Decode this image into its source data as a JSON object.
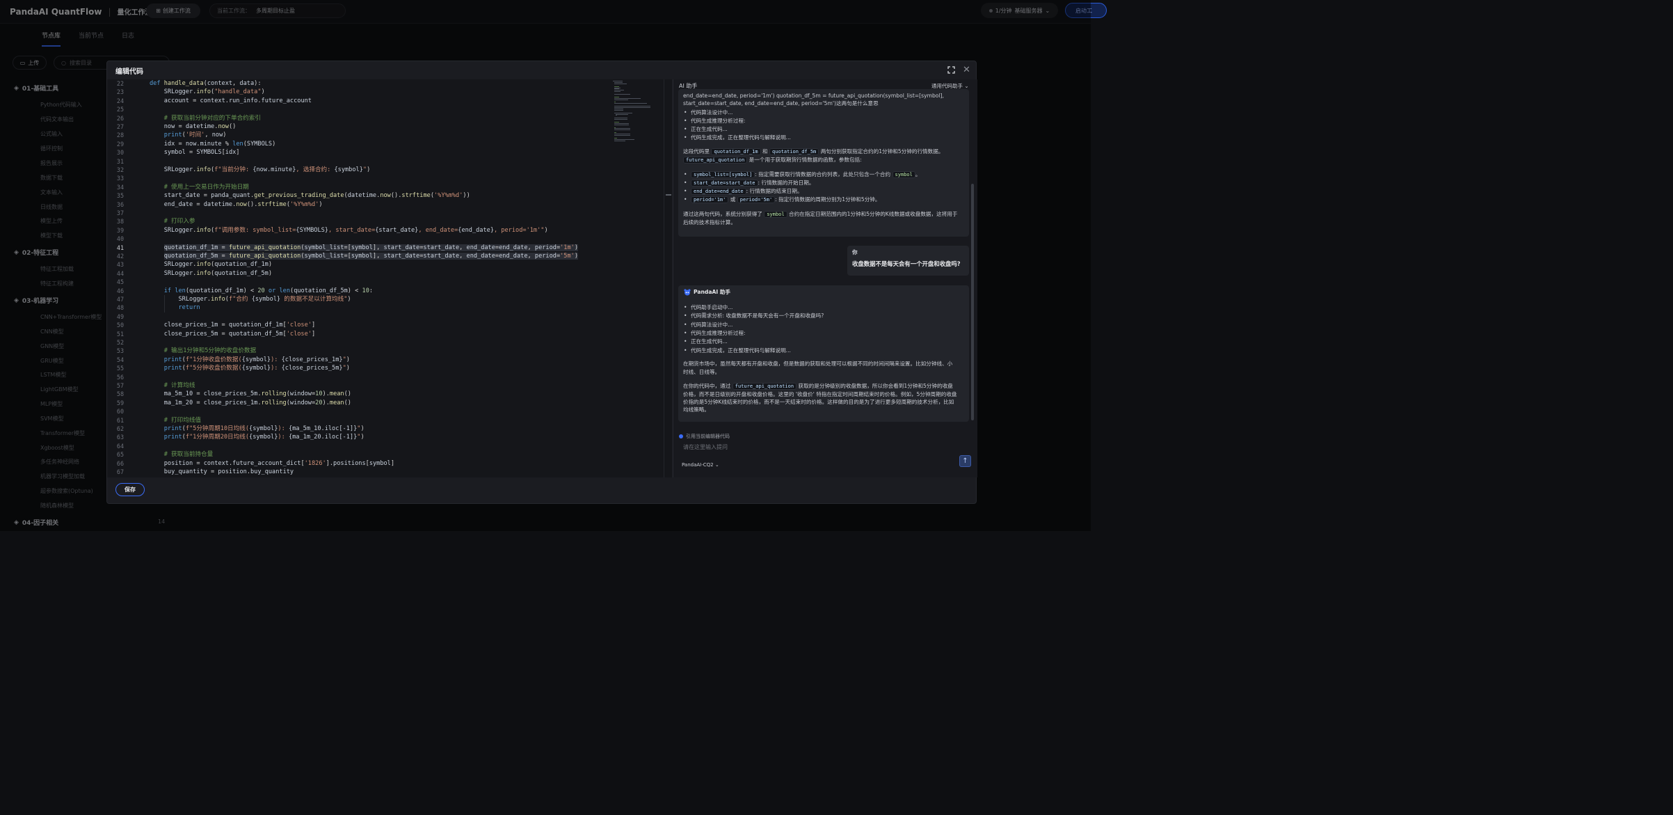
{
  "app": {
    "brand": "PandaAI QuantFlow",
    "subtitle": "量化工作流"
  },
  "topbar": {
    "create_label": "创建工作流",
    "workflow_prefix": "当前工作流：",
    "workflow_name": "多周期目标止盈",
    "rate_label": "1/分钟",
    "server_label": "基础服务器",
    "start_label": "启动工"
  },
  "left": {
    "tabs": [
      "节点库",
      "当前节点",
      "日志"
    ],
    "upload_label": "上传",
    "search_placeholder": "搜索目录",
    "categories": [
      {
        "name": "01-基础工具",
        "nodes": [
          "Python代码输入",
          "代码文本输出",
          "公式输入",
          "循环控制",
          "报告展示",
          "数据下载",
          "文本输入",
          "日线数据",
          "模型上传",
          "模型下载"
        ]
      },
      {
        "name": "02-特征工程",
        "nodes": [
          "特征工程加载",
          "特征工程构建"
        ]
      },
      {
        "name": "03-机器学习",
        "nodes": [
          "CNN+Transformer模型",
          "CNN模型",
          "GNN模型",
          "GRU模型",
          "LSTM模型",
          "LightGBM模型",
          "MLP模型",
          "SVM模型",
          "Transformer模型",
          "Xgboost模型",
          "多任务神经网络",
          "机器学习模型加载",
          "超参数搜索(Optuna)",
          "随机森林模型"
        ]
      },
      {
        "name": "04-因子相关",
        "nodes": []
      }
    ],
    "last_count": "14"
  },
  "modal": {
    "title": "编辑代码",
    "save_label": "保存",
    "code_lines": [
      {
        "n": "22",
        "t": "def handle_data(context, data):"
      },
      {
        "n": "23",
        "t": "    SRLogger.info(\"handle_data\")"
      },
      {
        "n": "24",
        "t": "    account = context.run_info.future_account"
      },
      {
        "n": "25",
        "t": ""
      },
      {
        "n": "26",
        "t": "    # 获取当前分钟对应的下单合约索引"
      },
      {
        "n": "27",
        "t": "    now = datetime.now()"
      },
      {
        "n": "28",
        "t": "    print('时间', now)"
      },
      {
        "n": "29",
        "t": "    idx = now.minute % len(SYMBOLS)"
      },
      {
        "n": "30",
        "t": "    symbol = SYMBOLS[idx]"
      },
      {
        "n": "31",
        "t": ""
      },
      {
        "n": "32",
        "t": "    SRLogger.info(f\"当前分钟: {now.minute}, 选择合约: {symbol}\")"
      },
      {
        "n": "33",
        "t": ""
      },
      {
        "n": "34",
        "t": "    # 使用上一交易日作为开始日期"
      },
      {
        "n": "35",
        "t": "    start_date = panda_quant.get_previous_trading_date(datetime.now().strftime('%Y%m%d'))"
      },
      {
        "n": "36",
        "t": "    end_date = datetime.now().strftime('%Y%m%d')"
      },
      {
        "n": "37",
        "t": ""
      },
      {
        "n": "38",
        "t": "    # 打印入参"
      },
      {
        "n": "39",
        "t": "    SRLogger.info(f\"调用参数: symbol_list={SYMBOLS}, start_date={start_date}, end_date={end_date}, period='1m'\")"
      },
      {
        "n": "40",
        "t": ""
      },
      {
        "n": "41",
        "t": "    quotation_df_1m = future_api_quotation(symbol_list=[symbol], start_date=start_date, end_date=end_date, period='1m')"
      },
      {
        "n": "42",
        "t": "    quotation_df_5m = future_api_quotation(symbol_list=[symbol], start_date=start_date, end_date=end_date, period='5m')"
      },
      {
        "n": "43",
        "t": "    SRLogger.info(quotation_df_1m)"
      },
      {
        "n": "44",
        "t": "    SRLogger.info(quotation_df_5m)"
      },
      {
        "n": "45",
        "t": ""
      },
      {
        "n": "46",
        "t": "    if len(quotation_df_1m) < 20 or len(quotation_df_5m) < 10:"
      },
      {
        "n": "47",
        "t": "        SRLogger.info(f\"合约 {symbol} 的数据不足以计算均线\")"
      },
      {
        "n": "48",
        "t": "        return"
      },
      {
        "n": "49",
        "t": ""
      },
      {
        "n": "50",
        "t": "    close_prices_1m = quotation_df_1m['close']"
      },
      {
        "n": "51",
        "t": "    close_prices_5m = quotation_df_5m['close']"
      },
      {
        "n": "52",
        "t": ""
      },
      {
        "n": "53",
        "t": "    # 输出1分钟和5分钟的收盘价数据"
      },
      {
        "n": "54",
        "t": "    print(f\"1分钟收盘价数据({symbol}): {close_prices_1m}\")"
      },
      {
        "n": "55",
        "t": "    print(f\"5分钟收盘价数据({symbol}): {close_prices_5m}\")"
      },
      {
        "n": "56",
        "t": ""
      },
      {
        "n": "57",
        "t": "    # 计算均线"
      },
      {
        "n": "58",
        "t": "    ma_5m_10 = close_prices_5m.rolling(window=10).mean()"
      },
      {
        "n": "59",
        "t": "    ma_1m_20 = close_prices_1m.rolling(window=20).mean()"
      },
      {
        "n": "60",
        "t": ""
      },
      {
        "n": "61",
        "t": "    # 打印均线值"
      },
      {
        "n": "62",
        "t": "    print(f\"5分钟周期10日均线({symbol}): {ma_5m_10.iloc[-1]}\")"
      },
      {
        "n": "63",
        "t": "    print(f\"1分钟周期20日均线({symbol}): {ma_1m_20.iloc[-1]}\")"
      },
      {
        "n": "64",
        "t": ""
      },
      {
        "n": "65",
        "t": "    # 获取当前持仓量"
      },
      {
        "n": "66",
        "t": "    position = context.future_account_dict['1826'].positions[symbol]"
      },
      {
        "n": "67",
        "t": "    buy_quantity = position.buy_quantity"
      }
    ]
  },
  "ai": {
    "title": "AI 助手",
    "selector": "通用代码助手",
    "msg1": {
      "head1": "end_date=end_date, period='1m') quotation_df_5m = future_api_quotation(symbol_list=[symbol],",
      "head2": "start_date=start_date, end_date=end_date, period='5m')这两句是什么意思",
      "steps": [
        "代码算法设计中...",
        "代码生成推理分析过程:",
        "正在生成代码...",
        "代码生成完成，正在整理代码与解释说明..."
      ],
      "p1a": "这段代码里",
      "p1_code1": "quotation_df_1m",
      "p1b": "和",
      "p1_code2": "quotation_df_5m",
      "p1c": "两句分别获取指定合约的1分钟和5分钟的行情数据。",
      "p1_code3": "future_api_quotation",
      "p1d": "是一个用于获取期货行情数据的函数，参数包括:",
      "params": [
        {
          "code": "symbol_list=[symbol]",
          "text": ": 指定需要获取行情数据的合约列表，此处只包含一个合约",
          "code2": "symbol",
          "tail": "。"
        },
        {
          "code": "start_date=start_date",
          "text": ": 行情数据的开始日期。",
          "code2": "",
          "tail": ""
        },
        {
          "code": "end_date=end_date",
          "text": ": 行情数据的结束日期。",
          "code2": "",
          "tail": ""
        }
      ],
      "period_a": "period='1m'",
      "period_or": "或",
      "period_b": "period='5m'",
      "period_text": ": 指定行情数据的周期分别为1分钟和5分钟。",
      "p2a": "通过这两句代码，系统分别获得了",
      "p2_code": "symbol",
      "p2b": "合约在指定日期范围内的1分钟和5分钟的K线数据或收盘数据，这将用于",
      "p2c": "后续的技术指标计算。"
    },
    "user": {
      "label": "你",
      "text": "收盘数据不是每天会有一个开盘和收盘吗?"
    },
    "msg2": {
      "name": "PandaAI 助手",
      "steps": [
        "代码助手启动中...",
        "代码需求分析:  收盘数据不是每天会有一个开盘和收盘吗?",
        "代码算法设计中...",
        "代码生成推理分析过程:",
        "正在生成代码...",
        "代码生成完成，正在整理代码与解释说明..."
      ],
      "p1": "在期货市场中，虽然每天都有开盘和收盘，但是数据的获取和处理可以根据不同的时间间隔来设置。比如分钟线、小",
      "p1b": "时线、日线等。",
      "p2a": "在你的代码中，通过",
      "p2_code": "future_api_quotation",
      "p2b": "获取的是分钟级别的收盘数据，所以你会看到1分钟和5分钟的收盘",
      "p2c": "价格，而不是日级别的开盘和收盘价格。这里的 '收盘价' 特指在指定时间周期结束时的价格。例如，5分钟周期的收盘",
      "p2d": "价指的是5分钟K线结束时的价格，而不是一天结束时的价格。这样做的目的是为了进行更多短周期的技术分析，比如",
      "p2e": "均线策略。"
    },
    "cite_label": "引用当前编辑器代码",
    "input_placeholder": "请在这里输入提问",
    "model_label": "PandaAI-CQ2 ⌄"
  }
}
